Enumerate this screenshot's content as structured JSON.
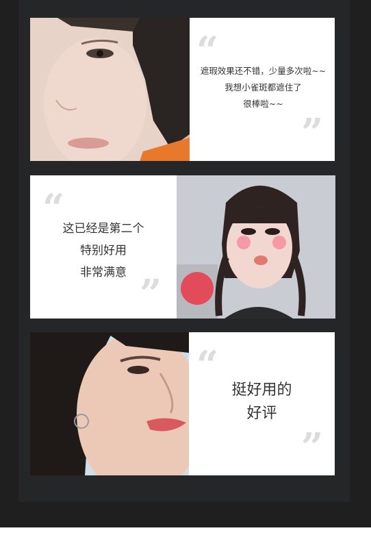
{
  "reviews": [
    {
      "lines": [
        "遮瑕效果还不错，少量多次啦~~",
        "我想小雀斑都遮住了",
        "很棒啦~~"
      ],
      "photo": "woman-face-short-hair"
    },
    {
      "lines": [
        "这已经是第二个",
        "特别好用",
        "非常满意"
      ],
      "photo": "girl-pouting-braids"
    },
    {
      "lines": [
        "挺好用的",
        "好评"
      ],
      "photo": "woman-face-long-hair"
    }
  ],
  "quote_open": "“",
  "quote_close": "”",
  "colors": {
    "background": "#1f1f20",
    "panel": "#252628",
    "card": "#ffffff",
    "quote": "#dcdcdc",
    "text": "#333333"
  }
}
